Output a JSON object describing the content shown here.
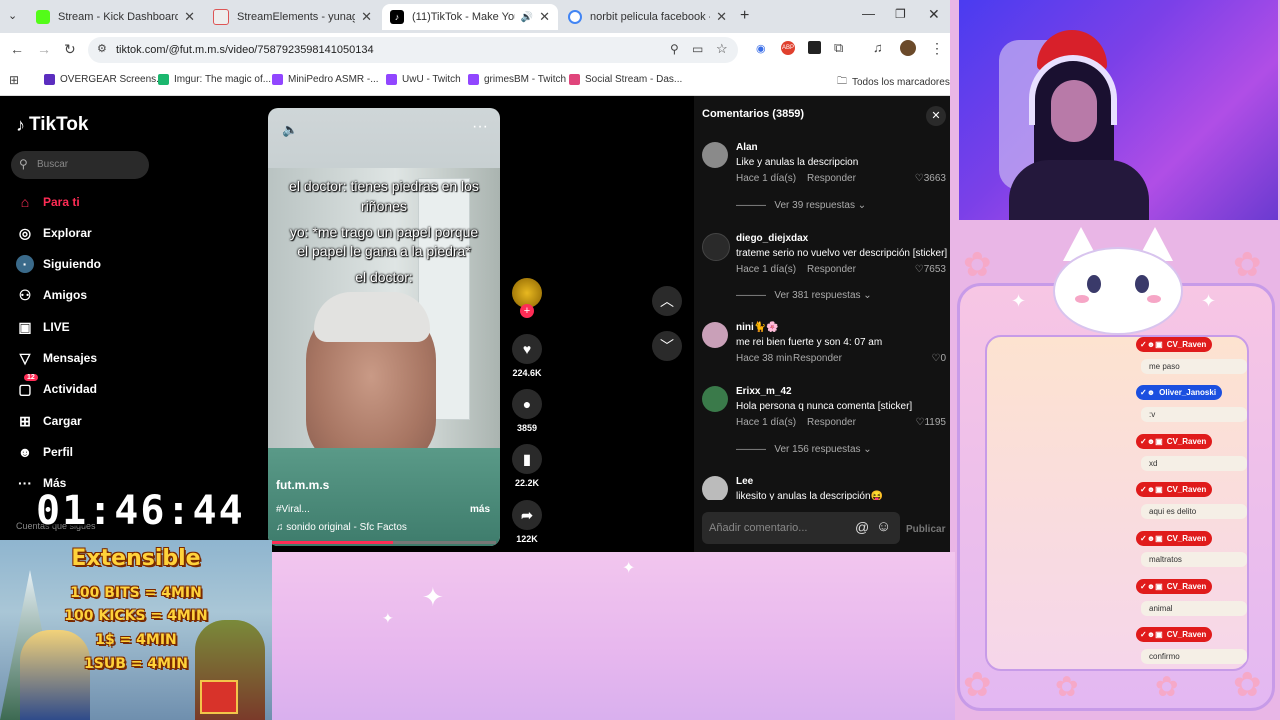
{
  "browser": {
    "tabs": [
      {
        "label": "Stream - Kick Dashboard",
        "color": "#53fc18"
      },
      {
        "label": "StreamElements - yunagiselle",
        "color": "#e8e8e8"
      },
      {
        "label": "(11)TikTok - Make Your Day",
        "color": "#000000"
      },
      {
        "label": "norbit pelicula facebook - Busc",
        "color": "#4285f4"
      }
    ],
    "url": "tiktok.com/@fut.m.m.s/video/7587923598141050134",
    "bookmarks": [
      {
        "label": "OVERGEAR Screens...",
        "color": "#5b2dbf"
      },
      {
        "label": "Imgur: The magic of...",
        "color": "#1bb76e"
      },
      {
        "label": "MiniPedro ASMR -...",
        "color": "#9146ff"
      },
      {
        "label": "UwU - Twitch",
        "color": "#9146ff"
      },
      {
        "label": "grimesBM - Twitch",
        "color": "#9146ff"
      },
      {
        "label": "Social Stream - Das...",
        "color": "#e0457b"
      }
    ],
    "all_bookmarks": "Todos los marcadores"
  },
  "tiktok": {
    "logo": "TikTok",
    "search_placeholder": "Buscar",
    "nav": [
      {
        "label": "Para ti",
        "icon": "home-icon",
        "active": true
      },
      {
        "label": "Explorar",
        "icon": "compass-icon"
      },
      {
        "label": "Siguiendo",
        "icon": "following-icon"
      },
      {
        "label": "Amigos",
        "icon": "friends-icon"
      },
      {
        "label": "LIVE",
        "icon": "live-icon"
      },
      {
        "label": "Mensajes",
        "icon": "messages-icon"
      },
      {
        "label": "Actividad",
        "icon": "activity-icon",
        "badge": "12"
      },
      {
        "label": "Cargar",
        "icon": "upload-icon"
      },
      {
        "label": "Perfil",
        "icon": "profile-icon"
      },
      {
        "label": "Más",
        "icon": "more-icon"
      }
    ],
    "following_label": "Cuentas que sigues",
    "video": {
      "caption_lines": [
        "el doctor: tienes piedras en los",
        "riñones",
        "yo: *me trago un papel porque",
        "el papel le gana a la piedra*",
        "el doctor:"
      ],
      "author": "fut.m.m.s",
      "desc": "#Viral...",
      "more": "más",
      "sound": "sonido original - Sfc Factos"
    },
    "actions": {
      "likes": "224.6K",
      "comments": "3859",
      "saves": "22.2K",
      "shares": "122K"
    },
    "comments": {
      "title": "Comentarios (3859)",
      "items": [
        {
          "name": "Alan",
          "text": "Like y anulas la descripcion",
          "time": "Hace 1 día(s)",
          "likes": "3663",
          "replies": "Ver 39 respuestas",
          "avatar": "#8a8a8a"
        },
        {
          "name": "diego_diejxdax",
          "text": "trateme serio no vuelvo ver descripción [sticker]",
          "time": "Hace 1 día(s)",
          "likes": "7653",
          "replies": "Ver 381 respuestas",
          "avatar": "#2a2a2a"
        },
        {
          "name": "nini�further🌸",
          "text": "me rei bien fuerte y son 4: 07 am",
          "time": "Hace 38 min",
          "likes": "0",
          "replies": "",
          "avatar": "#c9a0b8"
        },
        {
          "name": "Erixx_m_42",
          "text": "Hola persona q nunca comenta [sticker]",
          "time": "Hace 1 día(s)",
          "likes": "1195",
          "replies": "Ver 156 respuestas",
          "avatar": "#3a7a4a"
        },
        {
          "name": "Lee",
          "text": "likesito y anulas la descripción😝",
          "time": "",
          "likes": "",
          "replies": "",
          "avatar": "#bbbbbb"
        }
      ],
      "reply_label": "Responder",
      "input_placeholder": "Añadir comentario...",
      "publish": "Publicar"
    }
  },
  "overlay": {
    "timer": "01:46:44",
    "promo": [
      "Extensible",
      "100 BITS = 4MIN",
      "100 KICKS = 4MIN",
      "1$ = 4MIN",
      "1SUB = 4MIN"
    ],
    "chat": [
      {
        "user": "CV_Raven",
        "color": "#e01b1b",
        "msg": "me paso"
      },
      {
        "user": "Oliver_Janoski",
        "color": "#1b4fe0",
        "msg": ":v"
      },
      {
        "user": "CV_Raven",
        "color": "#e01b1b",
        "msg": "xd"
      },
      {
        "user": "CV_Raven",
        "color": "#e01b1b",
        "msg": "aqui es delito"
      },
      {
        "user": "CV_Raven",
        "color": "#e01b1b",
        "msg": "maltratos"
      },
      {
        "user": "CV_Raven",
        "color": "#e01b1b",
        "msg": "animal"
      },
      {
        "user": "CV_Raven",
        "color": "#e01b1b",
        "msg": "confirmo"
      }
    ]
  }
}
